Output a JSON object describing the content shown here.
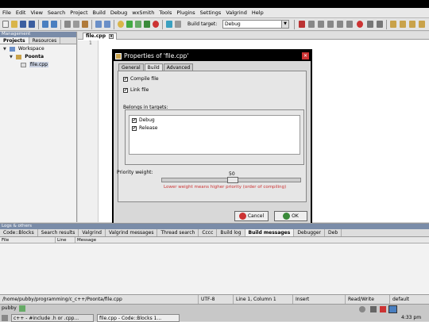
{
  "menu": [
    "File",
    "Edit",
    "View",
    "Search",
    "Project",
    "Build",
    "Debug",
    "wxSmith",
    "Tools",
    "Plugins",
    "Settings",
    "Valgrind",
    "Help"
  ],
  "toolbar": {
    "build_target_label": "Build target:",
    "build_target_value": "Debug"
  },
  "management": {
    "title": "Management",
    "tabs": [
      "Projects",
      "Resources"
    ],
    "tree": {
      "workspace": "Workspace",
      "project": "Poonta",
      "file": "file.cpp"
    }
  },
  "editor": {
    "tab_label": "file.cpp",
    "line_number": "1"
  },
  "dialog": {
    "title": "Properties of 'file.cpp'",
    "tabs": [
      "General",
      "Build",
      "Advanced"
    ],
    "compile_file": "Compile file",
    "link_file": "Link file",
    "belongs_label": "Belongs in targets:",
    "targets": [
      "Debug",
      "Release"
    ],
    "priority_label": "Priority weight:",
    "priority_value": "50",
    "priority_hint": "Lower weight means higher priority (order of compiling)",
    "cancel_label": "Cancel",
    "ok_label": "OK"
  },
  "logs": {
    "title": "Logs & others",
    "tabs": [
      "Code::Blocks",
      "Search results",
      "Valgrind",
      "Valgrind messages",
      "Thread search",
      "Cccc",
      "Build log",
      "Build messages",
      "Debugger",
      "Deb"
    ],
    "columns": [
      "File",
      "Line",
      "Message"
    ]
  },
  "status": {
    "path": "/home/pubby/programming/c_c++/Poonta/file.cpp",
    "encoding": "UTF-8",
    "position": "Line 1, Column 1",
    "mode": "Insert",
    "access": "Read/Write",
    "extra": "default"
  },
  "taskbar": {
    "user": "pubby",
    "tasks": [
      "c++ - #include .h or .cpp...",
      "file.cpp - Code::Blocks 1..."
    ],
    "clock": "4:33 pm"
  },
  "colors": {
    "panel_header": "#7a8ca8",
    "hint_red": "#cc3333"
  }
}
